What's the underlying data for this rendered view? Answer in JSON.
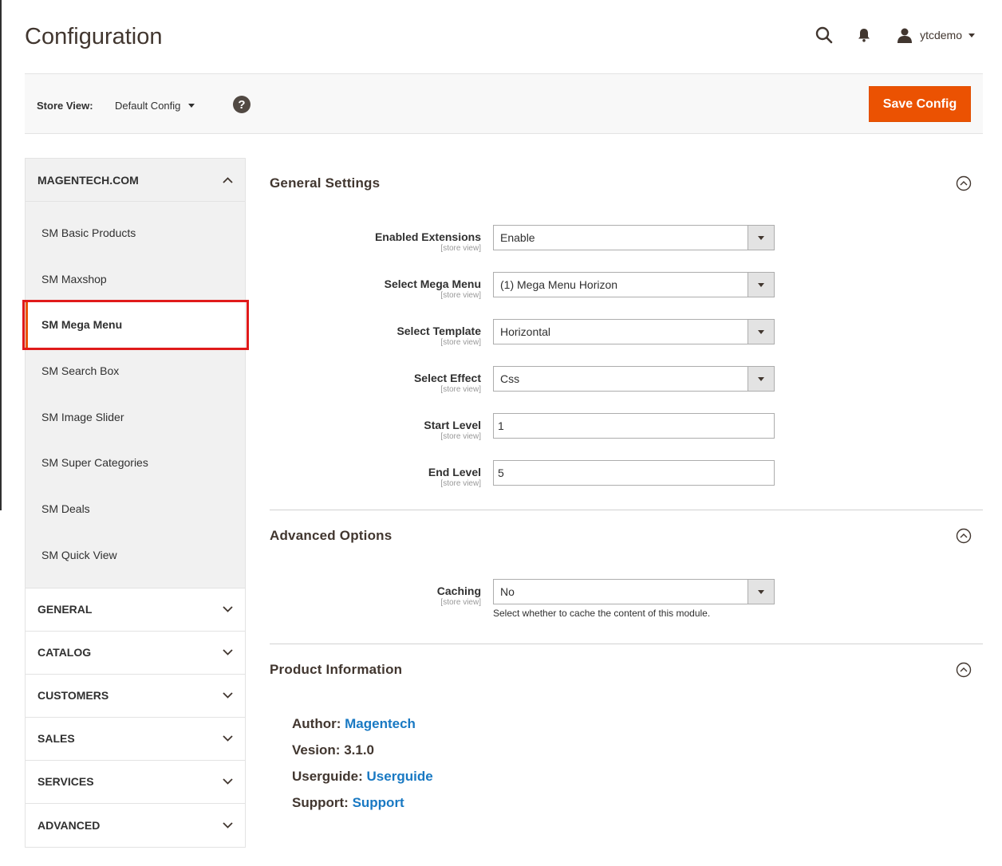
{
  "header": {
    "title": "Configuration",
    "user_name": "ytcdemo",
    "icons": [
      "search-icon",
      "bell-icon",
      "user-icon"
    ]
  },
  "store_bar": {
    "label": "Store View:",
    "value": "Default Config",
    "help_glyph": "?",
    "save_label": "Save Config"
  },
  "sidebar": {
    "open_section": "MAGENTECH.COM",
    "items": [
      "SM Basic Products",
      "SM Maxshop",
      "SM Mega Menu",
      "SM Search Box",
      "SM Image Slider",
      "SM Super Categories",
      "SM Deals",
      "SM Quick View"
    ],
    "active_item": "SM Mega Menu",
    "closed_sections": [
      "GENERAL",
      "CATALOG",
      "CUSTOMERS",
      "SALES",
      "SERVICES",
      "ADVANCED"
    ]
  },
  "general_settings": {
    "title": "General Settings",
    "scope": "[store view]",
    "fields": {
      "enabled_extensions": {
        "label": "Enabled Extensions",
        "value": "Enable"
      },
      "select_mega_menu": {
        "label": "Select Mega Menu",
        "value": "(1) Mega Menu Horizon"
      },
      "select_template": {
        "label": "Select Template",
        "value": "Horizontal"
      },
      "select_effect": {
        "label": "Select Effect",
        "value": "Css"
      },
      "start_level": {
        "label": "Start Level",
        "value": "1"
      },
      "end_level": {
        "label": "End Level",
        "value": "5"
      }
    }
  },
  "advanced_options": {
    "title": "Advanced Options",
    "caching": {
      "label": "Caching",
      "value": "No",
      "scope": "[store view]",
      "note": "Select whether to cache the content of this module."
    }
  },
  "product_information": {
    "title": "Product Information",
    "author_key": "Author:",
    "author_value": "Magentech",
    "version_key": "Vesion:",
    "version_value": "3.1.0",
    "userguide_key": "Userguide:",
    "userguide_value": "Userguide",
    "support_key": "Support:",
    "support_value": "Support"
  },
  "colors": {
    "accent": "#eb5202",
    "link": "#1979c3",
    "highlight": "#e01a1a"
  }
}
